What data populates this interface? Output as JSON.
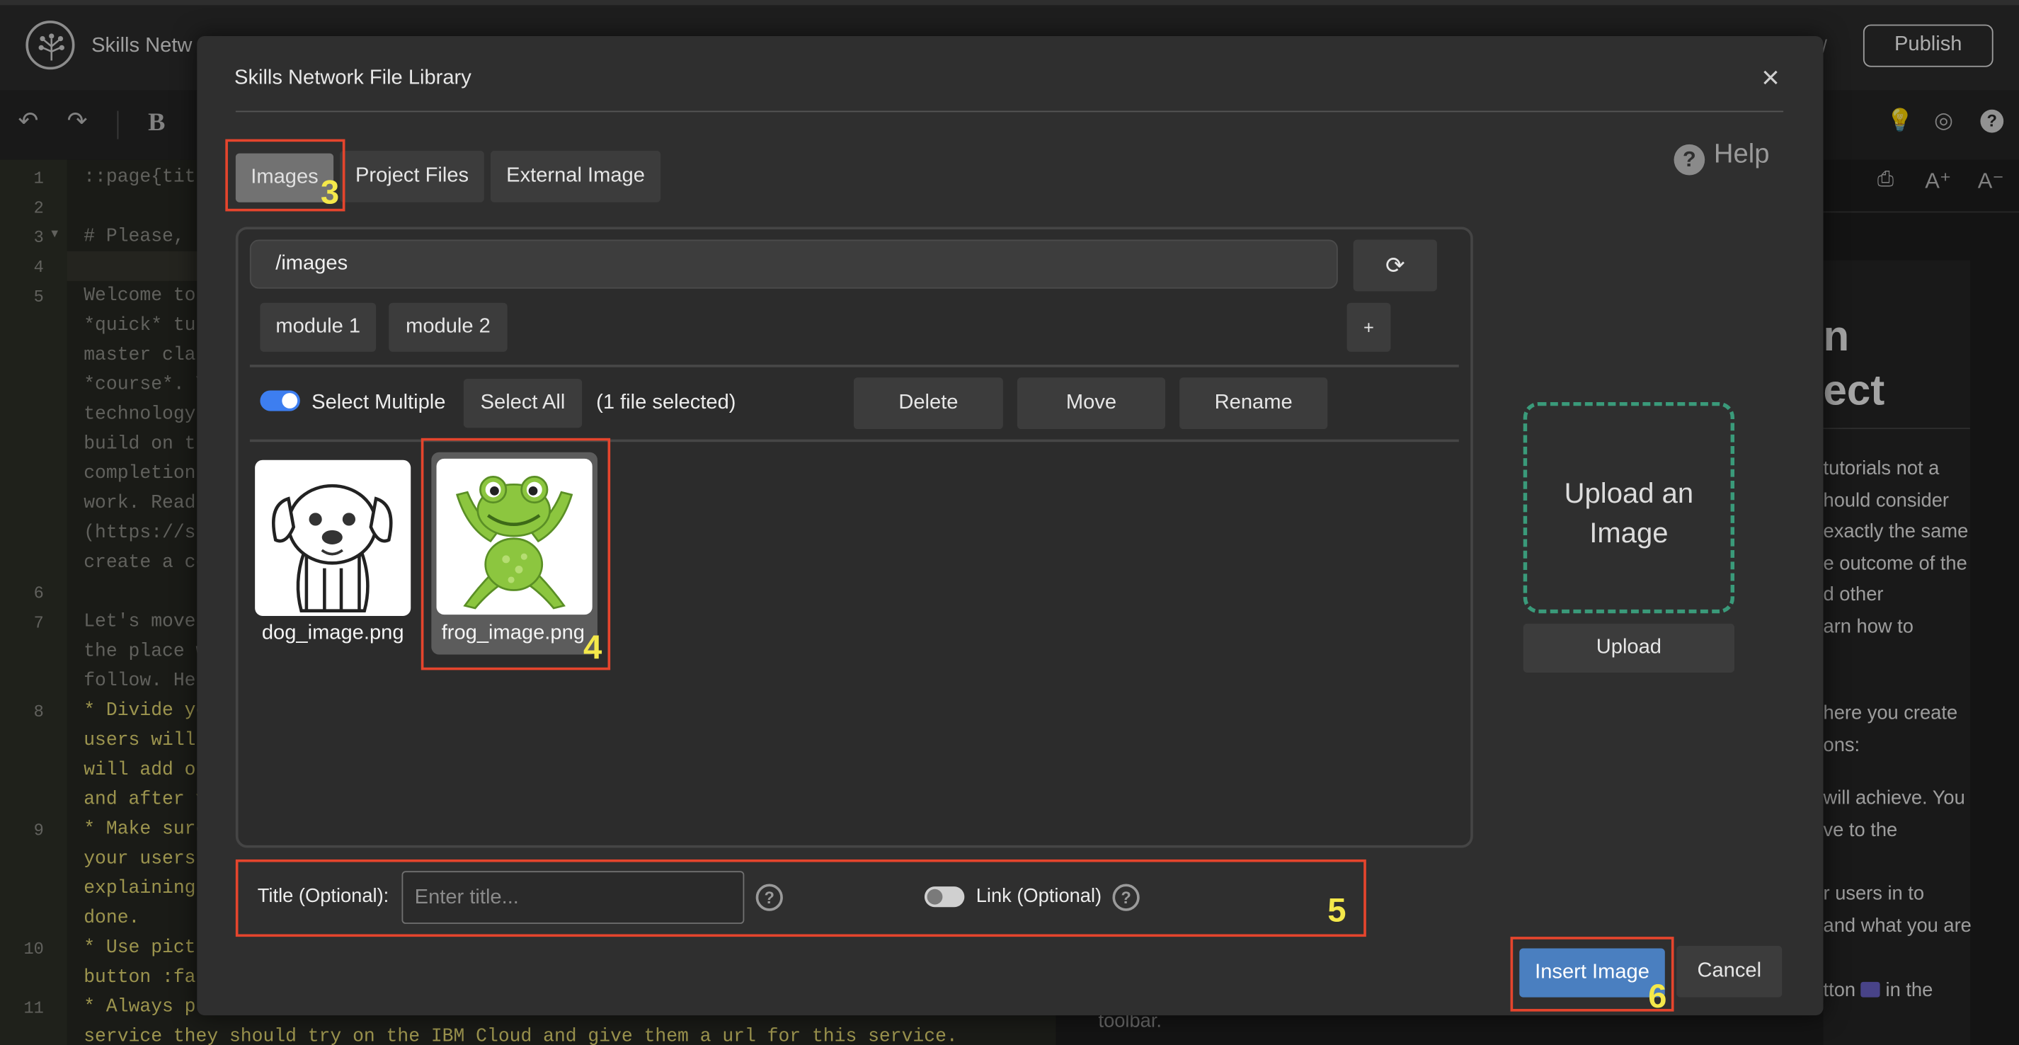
{
  "app": {
    "title": "Skills Netw",
    "publish_label": "Publish"
  },
  "toolbar": {
    "bold_label": "B"
  },
  "editor": {
    "line_numbers": [
      "1",
      "2",
      "3",
      "4",
      "5",
      "6",
      "7",
      "8",
      "9",
      "10",
      "11"
    ],
    "lines": [
      "::page{tit",
      "# Please, R",
      "Welcome to",
      "*quick* tut",
      "master clas",
      "*course*. Y",
      "technology",
      "build on th",
      "completion",
      "work. Read",
      "(https://su",
      "create a co",
      "Let's move",
      "the place w",
      "follow. Her",
      "* Divide yo",
      "users will",
      "will add on",
      "and after y",
      "* Make sure",
      "your users",
      "explaining",
      "done.",
      "* Use pictu",
      "button :fa",
      "* Always pr",
      "service they should try on the IBM Cloud and give them a url for this service."
    ]
  },
  "preview": {
    "heading_lines": [
      "n",
      "ect"
    ],
    "para1": [
      "tutorials not a",
      "hould consider",
      "exactly the same",
      "e outcome of the",
      "d other",
      "arn how to"
    ],
    "para2": [
      "here you create",
      "ons:"
    ],
    "para3": [
      "will achieve. You",
      "ve to the"
    ],
    "para4": [
      "r users in to",
      "and what you are"
    ],
    "para5_before": "tton",
    "para5_after": "in the",
    "para5_end": "toolbar."
  },
  "modal": {
    "title": "Skills Network File Library",
    "close": "×",
    "help_label": "Help",
    "tabs": [
      "Images",
      "Project Files",
      "External Image"
    ],
    "path": "/images",
    "folders": [
      "module 1",
      "module 2"
    ],
    "add_folder": "+",
    "select_multiple_label": "Select Multiple",
    "select_all_label": "Select All",
    "selection_count": "(1 file selected)",
    "actions": [
      "Delete",
      "Move",
      "Rename"
    ],
    "files": [
      {
        "name": "dog_image.png",
        "selected": false
      },
      {
        "name": "frog_image.png",
        "selected": true
      }
    ],
    "upload_zone_label": "Upload an Image",
    "upload_label": "Upload",
    "title_label": "Title (Optional):",
    "title_placeholder": "Enter title...",
    "link_label": "Link (Optional)",
    "insert_label": "Insert Image",
    "cancel_label": "Cancel"
  },
  "annotations": [
    "3",
    "4",
    "5",
    "6"
  ],
  "colors": {
    "primary": "#4a7fc0",
    "toggle_on": "#3d7ef0",
    "annotation_box": "#e5452d",
    "annotation_number": "#f4e84a",
    "upload_dash": "#3a9a7a"
  }
}
